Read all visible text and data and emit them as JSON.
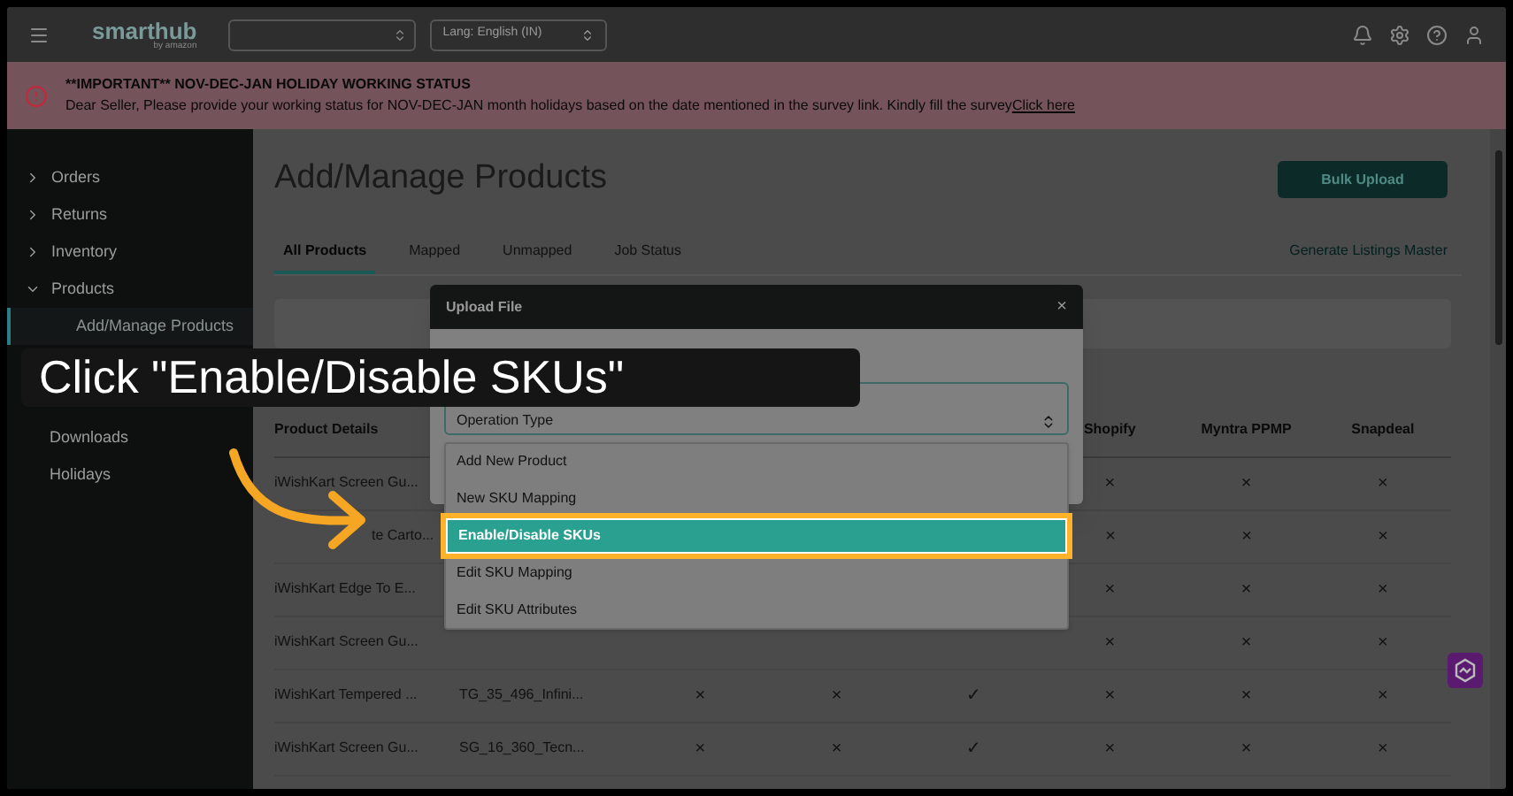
{
  "header": {
    "logo": "smarthub",
    "logo_sub": "by amazon",
    "language_select": "Lang: English (IN)"
  },
  "banner": {
    "title": "**IMPORTANT** NOV-DEC-JAN HOLIDAY WORKING STATUS",
    "body": "Dear Seller, Please provide your working status for NOV-DEC-JAN month holidays based on the date mentioned in the survey link. Kindly fill the survey",
    "link": "Click here"
  },
  "sidebar": {
    "items": [
      {
        "label": "Orders",
        "expanded": false,
        "selected": false
      },
      {
        "label": "Returns",
        "expanded": false,
        "selected": false
      },
      {
        "label": "Inventory",
        "expanded": false,
        "selected": false
      },
      {
        "label": "Products",
        "expanded": true,
        "selected": false,
        "children": [
          {
            "label": "Add/Manage Products",
            "selected": true
          }
        ]
      },
      {
        "label": "Downloads",
        "selected": false
      },
      {
        "label": "Holidays",
        "selected": false
      }
    ]
  },
  "page": {
    "title": "Add/Manage Products",
    "bulk_upload": "Bulk Upload",
    "generate_link": "Generate Listings Master",
    "tabs": [
      {
        "label": "All Products",
        "selected": true
      },
      {
        "label": "Mapped",
        "selected": false
      },
      {
        "label": "Unmapped",
        "selected": false
      },
      {
        "label": "Job Status",
        "selected": false
      }
    ]
  },
  "table": {
    "columns": [
      "Product Details",
      "Shopify",
      "Myntra PPMP",
      "Snapdeal"
    ],
    "rows": [
      {
        "product": "iWishKart Screen Gu...",
        "marks": [
          "×",
          "×",
          "×"
        ]
      },
      {
        "product": "te Carto...",
        "marks": [
          "×",
          "×",
          "×"
        ]
      },
      {
        "product": "iWishKart Edge To E...",
        "marks": [
          "×",
          "×",
          "×"
        ]
      },
      {
        "product": "iWishKart Screen Gu...",
        "marks": [
          "×",
          "×",
          "×"
        ]
      },
      {
        "product": "iWishKart Tempered ...",
        "sku": "TG_35_496_Infini...",
        "marks": [
          "×",
          "×",
          "✓",
          "×",
          "×",
          "×"
        ]
      },
      {
        "product": "iWishKart Screen Gu...",
        "sku": "SG_16_360_Tecn...",
        "marks": [
          "×",
          "×",
          "✓",
          "×",
          "×",
          "×"
        ]
      }
    ]
  },
  "modal": {
    "title": "Upload File",
    "close": "×",
    "select_placeholder": "Operation Type",
    "options": [
      {
        "label": "Add New Product",
        "selected": false
      },
      {
        "label": "New SKU Mapping",
        "selected": false
      },
      {
        "label": "Enable/Disable SKUs",
        "selected": true
      },
      {
        "label": "Edit SKU Mapping",
        "selected": false
      },
      {
        "label": "Edit SKU Attributes",
        "selected": false
      }
    ]
  },
  "callout": {
    "text": "Click \"Enable/Disable SKUs\""
  }
}
